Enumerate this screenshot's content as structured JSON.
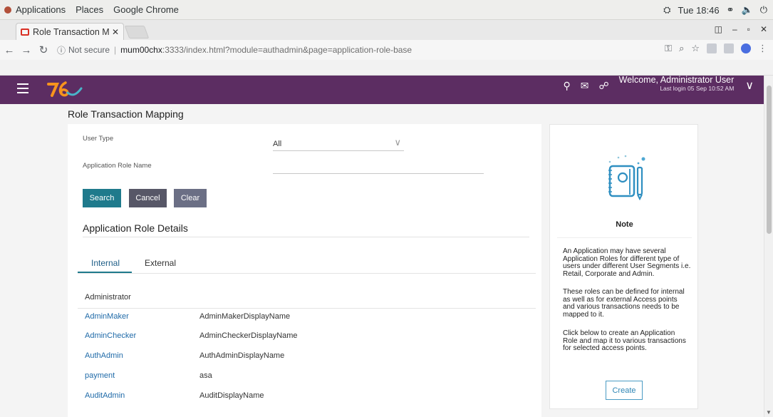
{
  "gnome_bar": {
    "menu": [
      "Applications",
      "Places",
      "Google Chrome"
    ],
    "clock": "Tue 18:46"
  },
  "browser": {
    "tab_title": "Role Transaction M",
    "url_info": "ⓘ",
    "url_security": "Not secure",
    "url_host": "mum00chx",
    "url_path": ":3333/index.html?module=authadmin&page=application-role-base"
  },
  "header": {
    "welcome": "Welcome, Administrator User",
    "last_login": "Last login 05 Sep 10:52 AM",
    "brand_colors": {
      "primary": "#5c2d62",
      "logo_orange": "#f7941d",
      "logo_teal": "#49b5c9"
    }
  },
  "page": {
    "title": "Role Transaction Mapping",
    "form": {
      "user_type_label": "User Type",
      "user_type_value": "All",
      "app_role_label": "Application Role Name",
      "app_role_value": "",
      "search": "Search",
      "cancel": "Cancel",
      "clear": "Clear"
    },
    "details": {
      "title": "Application Role Details",
      "tabs": [
        "Internal",
        "External"
      ],
      "group_header": "Administrator",
      "rows": [
        {
          "name": "AdminMaker",
          "display": "AdminMakerDisplayName"
        },
        {
          "name": "AdminChecker",
          "display": "AdminCheckerDisplayName"
        },
        {
          "name": "AuthAdmin",
          "display": "AuthAdminDisplayName"
        },
        {
          "name": "payment",
          "display": "asa"
        },
        {
          "name": "AuditAdmin",
          "display": "AuditDisplayName"
        }
      ]
    }
  },
  "note": {
    "title": "Note",
    "paragraphs": [
      "An Application may have several Application Roles for different type of users under different User Segments i.e. Retail, Corporate and Admin.",
      "These roles can be defined for internal as well as for external Access points and various transactions needs to be mapped to it.",
      "Click below to create an Application Role and map it to various transactions for selected access points."
    ],
    "create": "Create"
  }
}
